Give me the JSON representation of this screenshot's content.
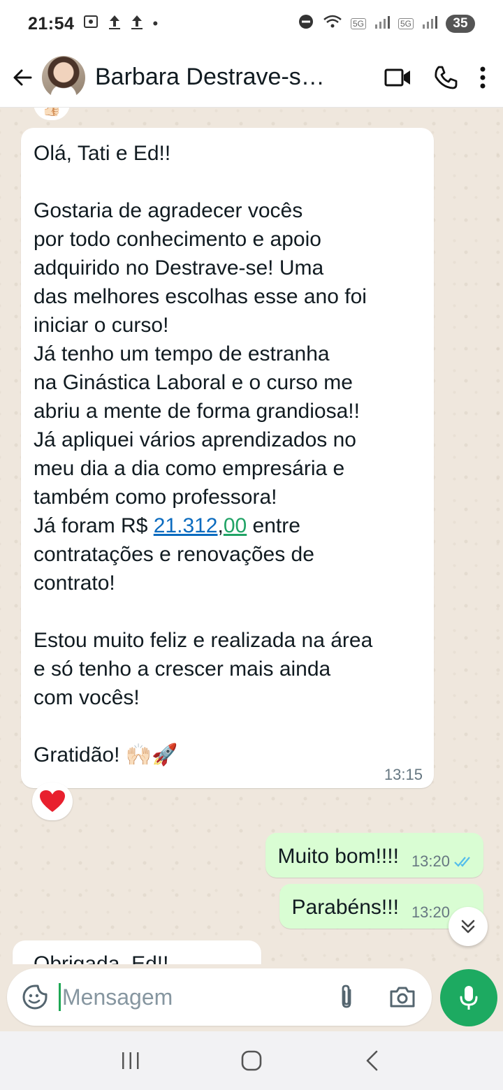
{
  "status_bar": {
    "time": "21:54",
    "battery": "35",
    "network_1": "5G",
    "network_2": "5G"
  },
  "header": {
    "contact_name": "Barbara Destrave-s…",
    "icons": [
      "back-arrow-icon",
      "avatar",
      "video-call-icon",
      "phone-icon",
      "more-vert-icon"
    ]
  },
  "messages": {
    "incoming_1": {
      "greeting": "Olá, Tati e Ed!!",
      "body_before": "Gostaria de agradecer vocês\npor todo conhecimento e apoio\nadquirido no Destrave-se! Uma\ndas melhores escolhas esse ano foi\niniciar o curso!\nJá tenho um tempo de estranha\nna Ginástica Laboral e o curso me\nabriu a mente de forma grandiosa!!\nJá apliquei vários aprendizados no\nmeu dia a dia como empresária e\ntambém como professora!\nJá foram R$ ",
      "amount_main": "21.312",
      "amount_sep": ",",
      "amount_cents": "00",
      "body_after": " entre\ncontratações e renovações de\ncontrato!",
      "closing_1": "Estou muito feliz e realizada na área\ne só tenho a crescer mais ainda\ncom vocês!",
      "closing_2": "Gratidão! 🙌🏻🚀",
      "time": "13:15",
      "reaction": "heart"
    },
    "outgoing_1": {
      "text": "Muito bom!!!!",
      "time": "13:20",
      "status": "read"
    },
    "outgoing_2": {
      "text": "Parabéns!!!",
      "time": "13:20",
      "status": "read"
    },
    "incoming_2_partial": {
      "text": "Obrigada, Ed!!"
    }
  },
  "composer": {
    "placeholder": "Mensagem"
  },
  "colors": {
    "accent_green": "#1daa61",
    "outgoing_bubble": "#d9fdd3",
    "read_ticks": "#53bdeb",
    "chat_bg": "#efe7dd"
  }
}
